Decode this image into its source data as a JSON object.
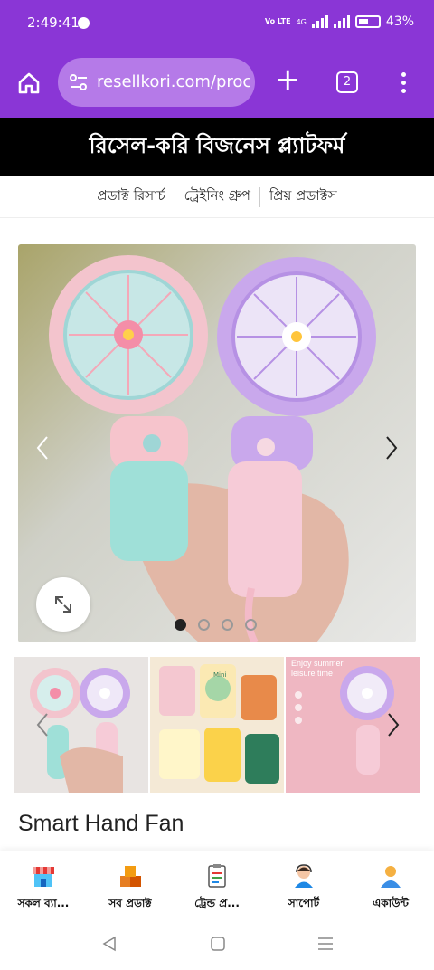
{
  "status": {
    "time": "2:49:41",
    "network": "Vo LTE",
    "network_gen": "4G",
    "battery": "43%",
    "battery_level": 0.43
  },
  "browser": {
    "url": "resellkori.com/proc",
    "tab_count": "2",
    "icons": [
      "home-icon",
      "site-settings-icon",
      "new-tab-icon",
      "tabs-icon",
      "overflow-menu-icon"
    ]
  },
  "banner": {
    "title": "রিসেল-করি বিজনেস প্ল্যাটফর্ম"
  },
  "subnav": {
    "items": [
      "প্রডাক্ট রিসার্চ",
      "ট্রেইনিং গ্রুপ",
      "প্রিয় প্রডাক্টস"
    ]
  },
  "gallery": {
    "slide_count": 4,
    "active_slide": 1
  },
  "product": {
    "title": "Smart Hand Fan"
  },
  "thumbnail_text": {
    "t3_heading": "Enjoy summer leisure time"
  },
  "bottom_nav": {
    "items": [
      {
        "label": "সকল ব্যা...",
        "icon": "store-icon"
      },
      {
        "label": "সব প্রডাক্ট",
        "icon": "boxes-icon"
      },
      {
        "label": "ট্রেন্ড প্র...",
        "icon": "clipboard-icon"
      },
      {
        "label": "সাপোর্ট",
        "icon": "support-agent-icon"
      },
      {
        "label": "একাউন্ট",
        "icon": "account-icon"
      }
    ]
  },
  "system_nav": {
    "icons": [
      "back-icon",
      "home-square-icon",
      "recents-icon"
    ]
  },
  "colors": {
    "brand_purple": "#8a36d6",
    "urlbox": "#b57ae8",
    "banner": "#000000"
  }
}
